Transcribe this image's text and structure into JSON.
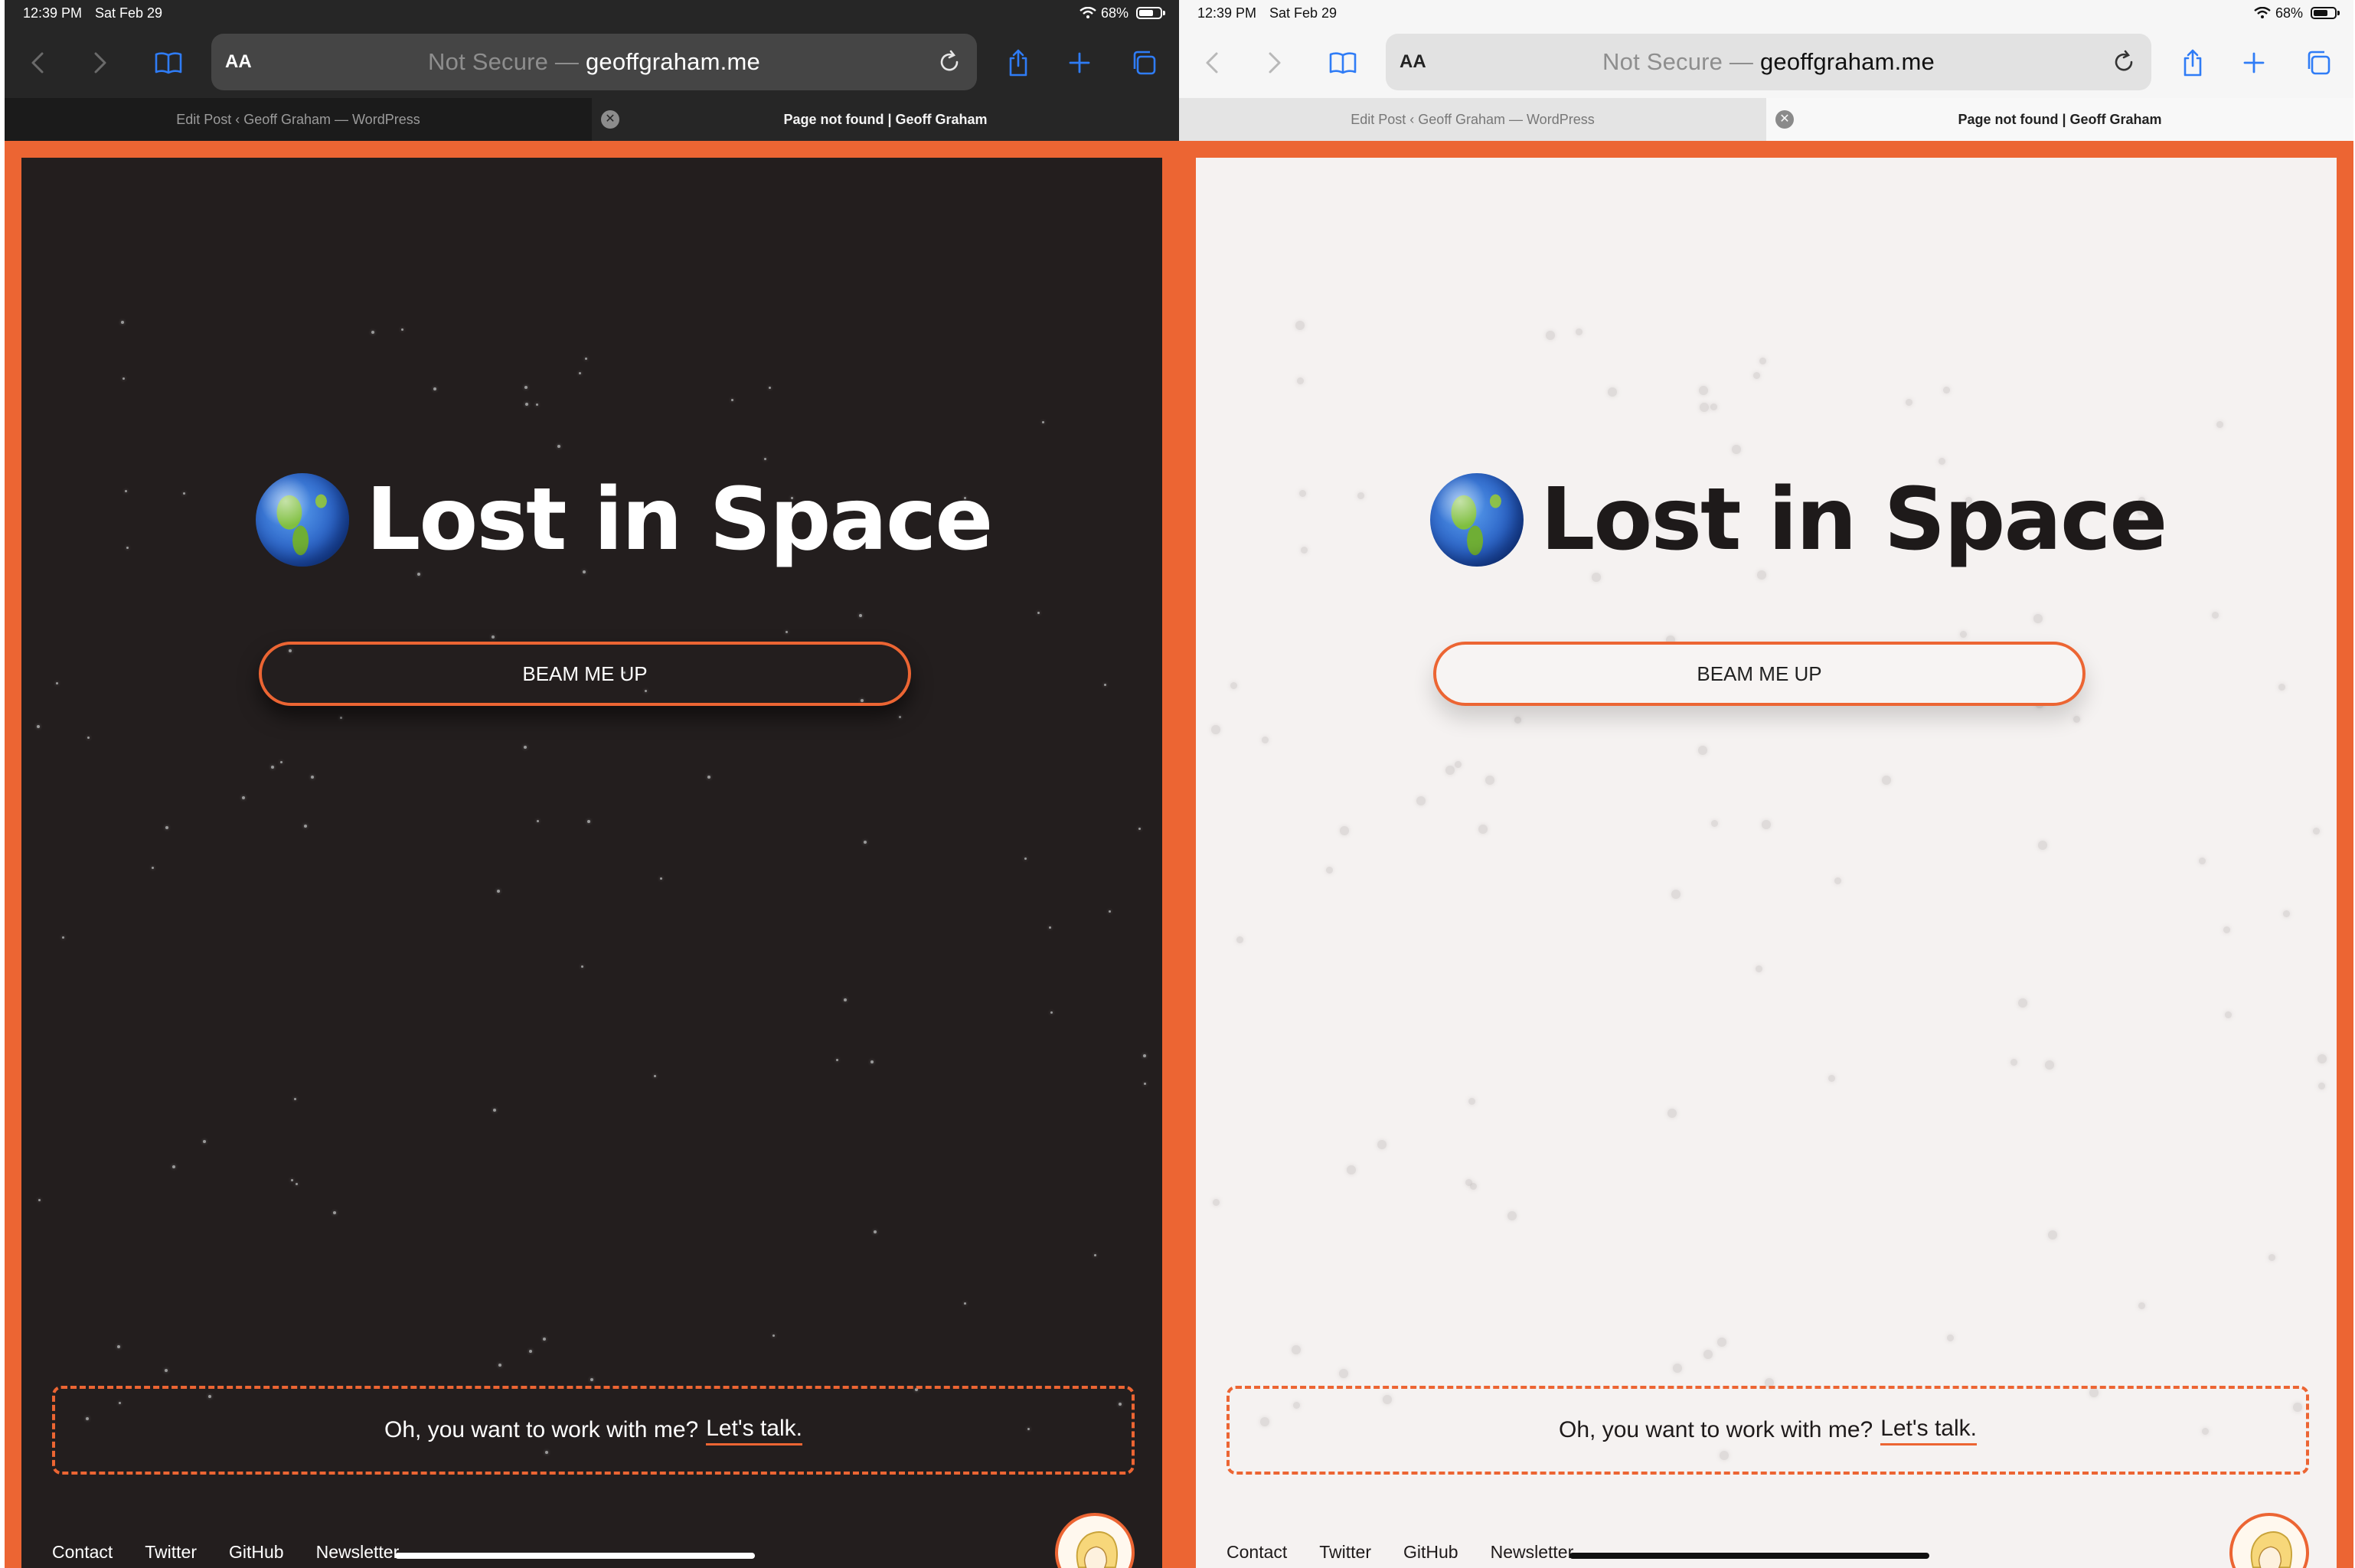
{
  "status": {
    "time": "12:39 PM",
    "date": "Sat Feb 29",
    "battery": "68%",
    "battery_level": 0.68
  },
  "browser": {
    "aa_label": "AA",
    "url_prefix": "Not Secure — ",
    "url_domain": "geoffgraham.me",
    "tabs": [
      {
        "title": "Edit Post ‹ Geoff Graham — WordPress"
      },
      {
        "title": "Page not found | Geoff Graham"
      }
    ],
    "tab_close_glyph": "✕"
  },
  "page": {
    "title": "Lost in Space",
    "globe_icon": "earth-americas-emoji",
    "cta_button": "BEAM ME UP",
    "work_text": "Oh, you want to work with me?",
    "work_link": "Let's talk.",
    "footer_links": [
      "Contact",
      "Twitter",
      "GitHub",
      "Newsletter"
    ],
    "accent_color": "#ec6533"
  },
  "themes": [
    {
      "name": "dark",
      "background": "#231e1e",
      "text": "#ffffff"
    },
    {
      "name": "light",
      "background": "#f5f2f1",
      "text": "#1e1a1a"
    }
  ]
}
